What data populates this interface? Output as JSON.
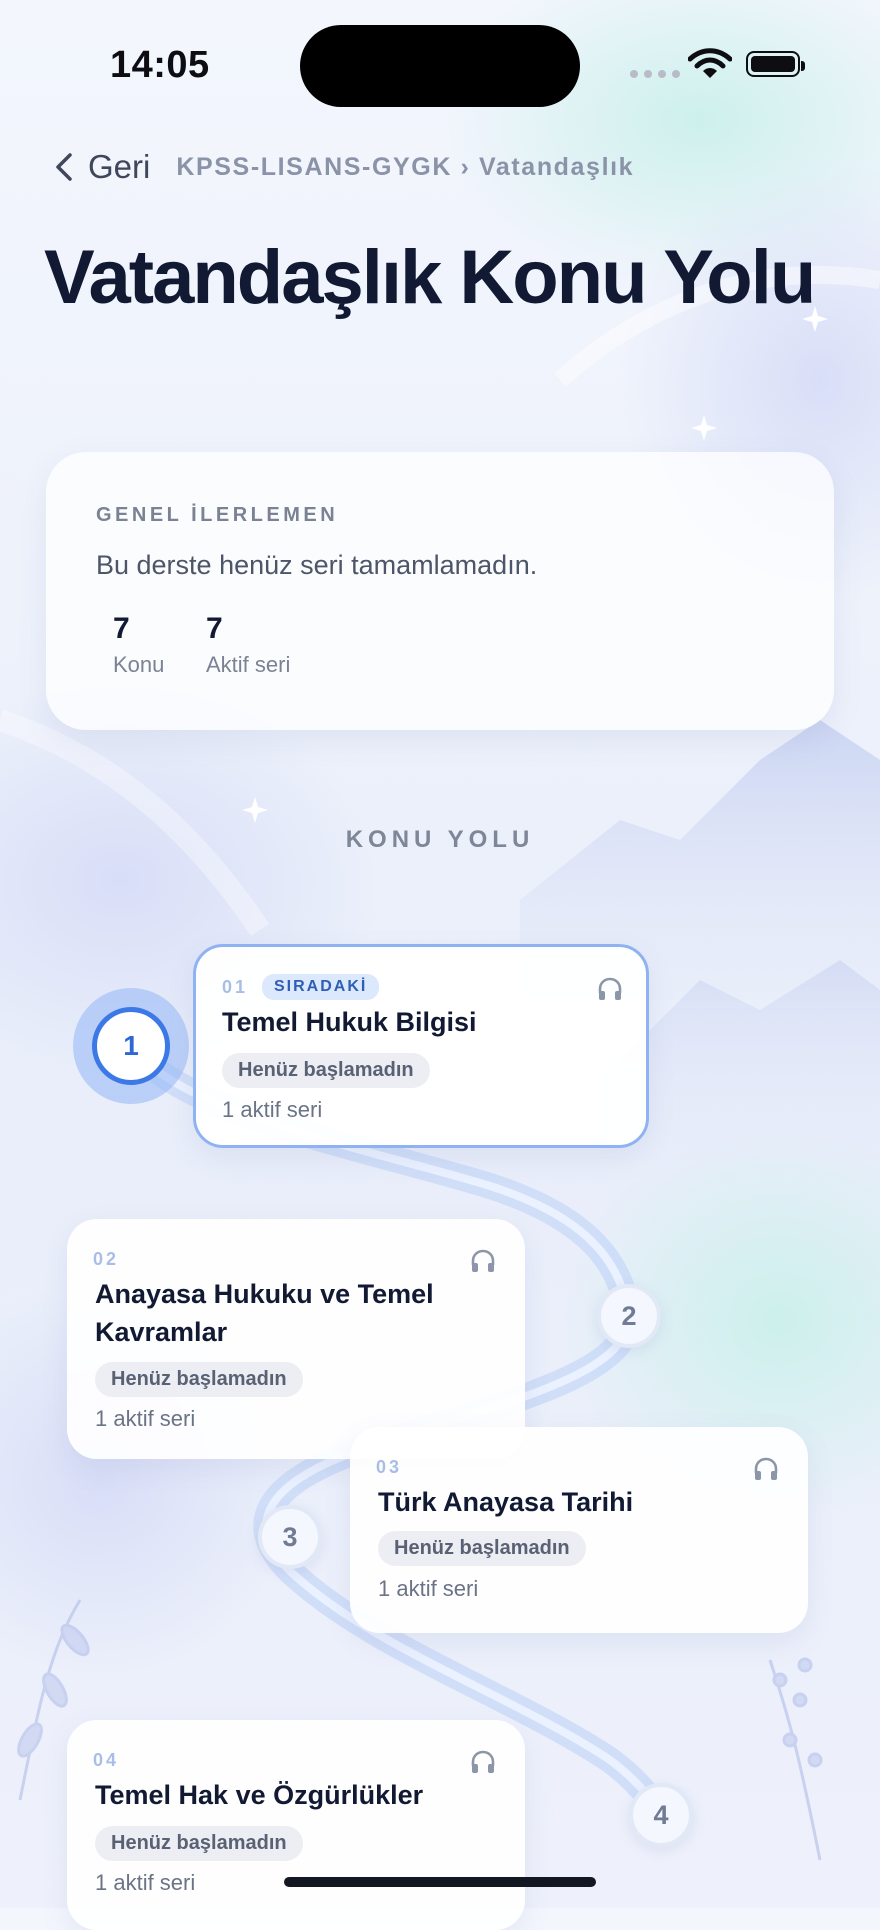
{
  "status_bar": {
    "time": "14:05"
  },
  "nav": {
    "back_label": "Geri",
    "breadcrumb": "KPSS-LISANS-GYGK › Vatandaşlık"
  },
  "page": {
    "title": "Vatandaşlık Konu Yolu"
  },
  "progress": {
    "label": "GENEL İLERLEMEN",
    "text": "Bu derste henüz seri tamamlamadın.",
    "stats": [
      {
        "value": "7",
        "label": "Konu"
      },
      {
        "value": "7",
        "label": "Aktif seri"
      }
    ]
  },
  "section_title": "KONU YOLU",
  "topics": [
    {
      "number": "01",
      "badge": "SIRADAKİ",
      "title": "Temel Hukuk Bilgisi",
      "status": "Henüz başlamadın",
      "series": "1 aktif seri",
      "node": "1"
    },
    {
      "number": "02",
      "title": "Anayasa Hukuku ve Temel Kavramlar",
      "status": "Henüz başlamadın",
      "series": "1 aktif seri",
      "node": "2"
    },
    {
      "number": "03",
      "title": "Türk Anayasa Tarihi",
      "status": "Henüz başlamadın",
      "series": "1 aktif seri",
      "node": "3"
    },
    {
      "number": "04",
      "title": "Temel Hak ve Özgürlükler",
      "status": "Henüz başlamadın",
      "series": "1 aktif seri",
      "node": "4"
    }
  ],
  "icons": {
    "back": "chevron-left-icon",
    "audio": "headphones-icon",
    "wifi": "wifi-icon",
    "battery": "battery-icon",
    "signal": "signal-icon"
  },
  "colors": {
    "accent": "#3c78e6",
    "active_border": "#8fb3f2",
    "title": "#121a33"
  }
}
